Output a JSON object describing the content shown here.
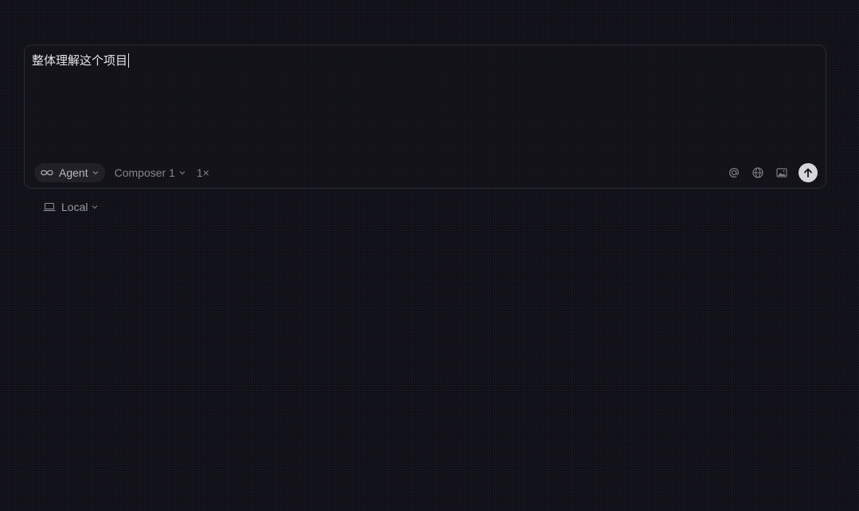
{
  "composer": {
    "prompt_text": "整体理解这个项目",
    "mode": {
      "label": "Agent",
      "icon": "infinity-icon"
    },
    "model": {
      "label": "Composer 1"
    },
    "multiplier": "1×",
    "tools": [
      {
        "name": "mention-icon"
      },
      {
        "name": "globe-icon"
      },
      {
        "name": "image-icon"
      }
    ],
    "send_icon": "arrow-up-icon"
  },
  "environment": {
    "label": "Local",
    "icon": "laptop-icon"
  },
  "colors": {
    "background": "#0e0e12",
    "text": "#e6e6e8",
    "muted": "#85858c",
    "send_button": "#d6d6da"
  }
}
